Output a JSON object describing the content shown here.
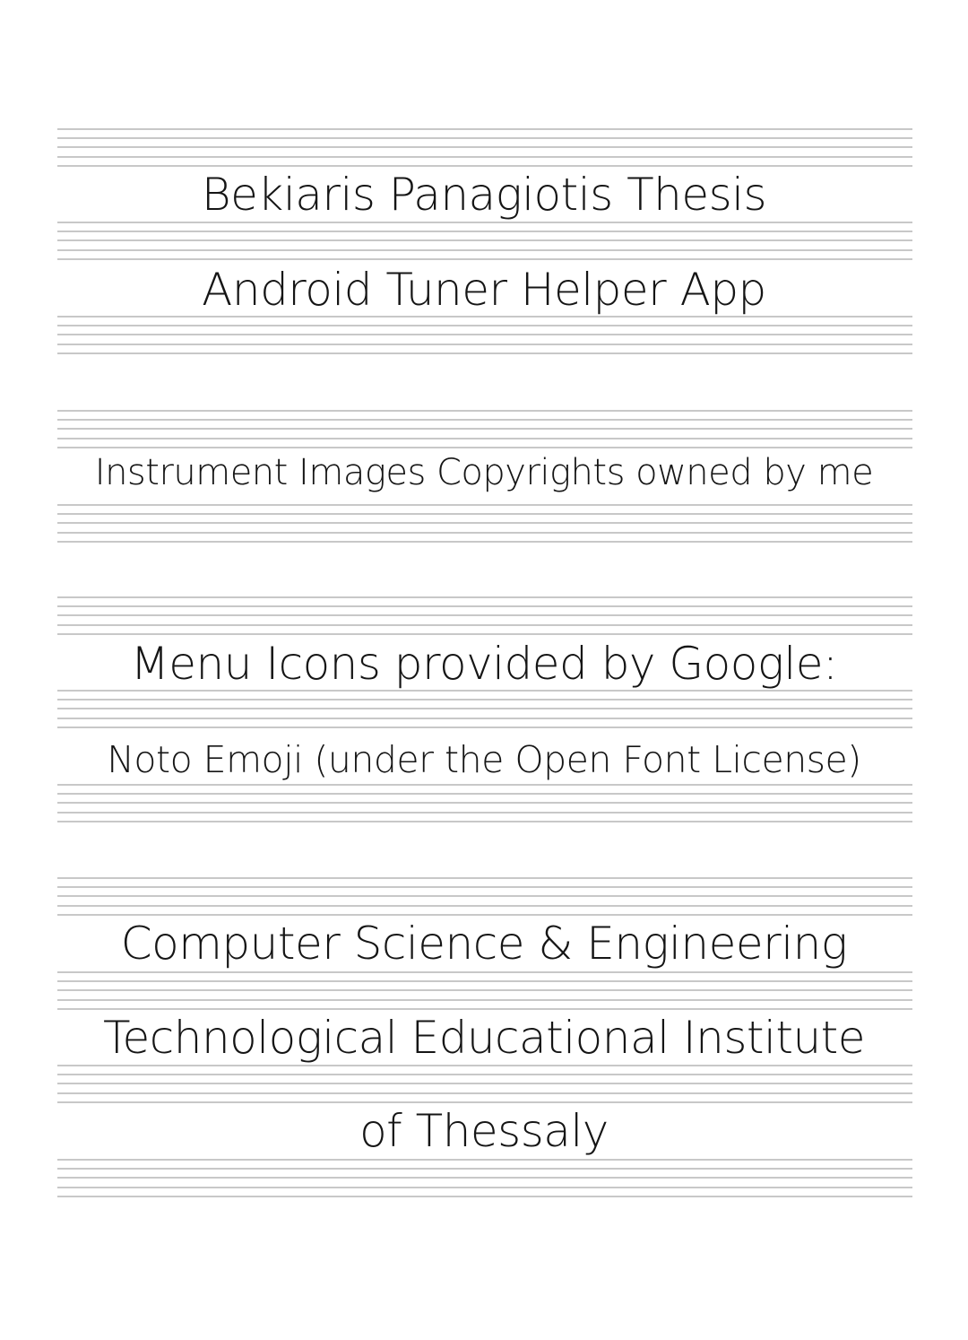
{
  "title_block": {
    "line1": "Bekiaris Panagiotis Thesis",
    "line2": "Android Tuner Helper App"
  },
  "copyright_block": {
    "line1": "Instrument Images Copyrights owned by me"
  },
  "icons_block": {
    "line1": "Menu Icons provided by Google:",
    "line2": "Noto Emoji (under the Open Font License)"
  },
  "institute_block": {
    "line1": "Computer Science & Engineering",
    "line2": "Technological Educational Institute",
    "line3": "of Thessaly"
  },
  "colors": {
    "staff_line": "#c8c8c8",
    "text": "#151515",
    "background": "#ffffff"
  }
}
